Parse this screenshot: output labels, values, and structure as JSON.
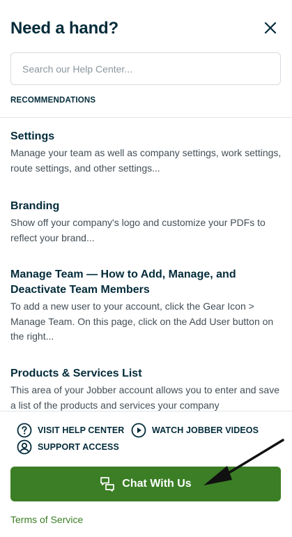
{
  "header": {
    "title": "Need a hand?",
    "close_icon": "close-icon"
  },
  "search": {
    "placeholder": "Search our Help Center..."
  },
  "recommendations": {
    "heading": "RECOMMENDATIONS",
    "articles": [
      {
        "title": "Settings",
        "description": "Manage your team as well as company settings, work settings, route settings, and other settings..."
      },
      {
        "title": "Branding",
        "description": "Show off your company's logo and customize your PDFs to reflect your brand..."
      },
      {
        "title": "Manage Team — How to Add, Manage, and Deactivate Team Members",
        "description": "To add a new user to your account, click the Gear Icon > Manage Team. On this page, click on the Add User button on the right..."
      },
      {
        "title": "Products & Services List",
        "description": "This area of your Jobber account allows you to enter and save a list of the products and services your company"
      }
    ]
  },
  "footer": {
    "visit_help_center": {
      "label": "VISIT HELP CENTER",
      "icon": "question-circle-icon"
    },
    "watch_videos": {
      "label": "WATCH JOBBER VIDEOS",
      "icon": "play-circle-icon"
    },
    "support_access": {
      "label": "SUPPORT ACCESS",
      "icon": "user-circle-icon"
    },
    "chat_button": {
      "label": "Chat With Us",
      "icon": "chat-bubbles-icon"
    },
    "terms": "Terms of Service"
  },
  "colors": {
    "primary_text": "#032b3a",
    "brand_green": "#3b7e25",
    "muted_text": "#424e56",
    "border": "#d5dbe0"
  }
}
